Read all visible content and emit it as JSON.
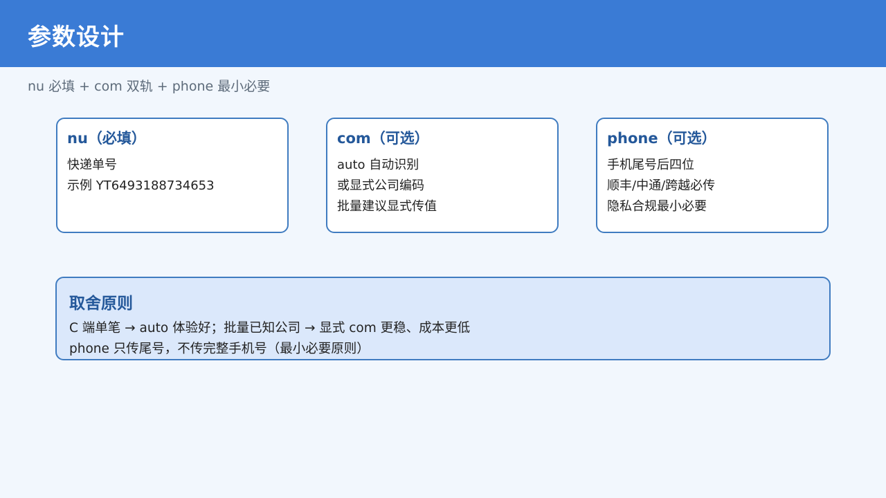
{
  "header": {
    "title": "参数设计"
  },
  "subtitle": "nu 必填 + com 双轨 + phone 最小必要",
  "cards": [
    {
      "title": "nu（必填）",
      "lines": [
        "快递单号",
        "示例 YT6493188734653"
      ]
    },
    {
      "title": "com（可选）",
      "lines": [
        "auto 自动识别",
        "或显式公司编码",
        "批量建议显式传值"
      ]
    },
    {
      "title": "phone（可选）",
      "lines": [
        "手机尾号后四位",
        "顺丰/中通/跨越必传",
        "隐私合规最小必要"
      ]
    }
  ],
  "principle": {
    "title": "取舍原则",
    "lines": [
      "C 端单笔 → auto 体验好；批量已知公司 → 显式 com 更稳、成本更低",
      "phone 只传尾号，不传完整手机号（最小必要原则）"
    ]
  },
  "colors": {
    "header_bg": "#3a7bd5",
    "page_bg": "#f2f7fd",
    "accent": "#24589a",
    "card_border": "#3f7bc0",
    "principle_bg": "#dbe8fb"
  }
}
